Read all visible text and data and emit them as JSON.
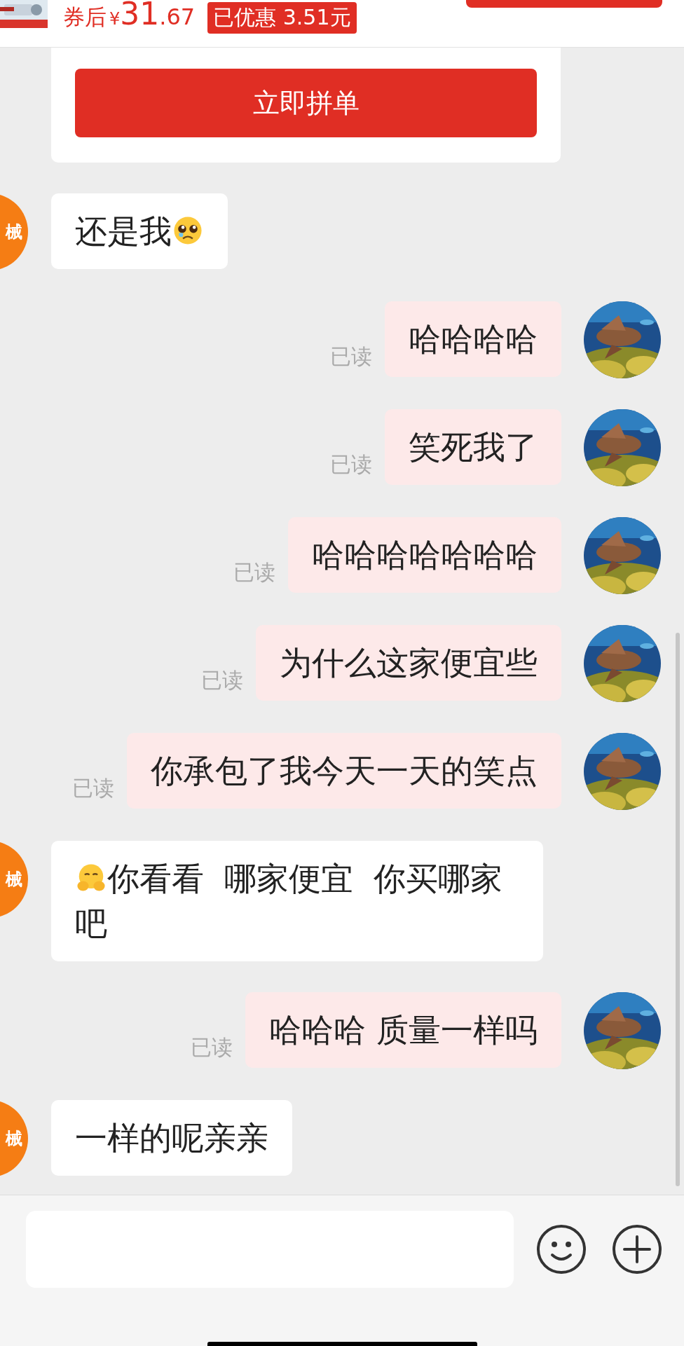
{
  "product": {
    "price_label": "券后",
    "currency": "¥",
    "price_int": "31",
    "price_dec": ".67",
    "discount": "已优惠 3.51元"
  },
  "order_button": "立即拼单",
  "messages": [
    {
      "kind": "incoming",
      "avatar_text": "械",
      "parts": [
        {
          "kind": "text",
          "text": "还是我"
        },
        {
          "kind": "pleading"
        }
      ]
    },
    {
      "kind": "outgoing",
      "status": "已读",
      "parts": [
        {
          "kind": "text",
          "text": "哈哈哈哈"
        }
      ]
    },
    {
      "kind": "outgoing",
      "status": "已读",
      "parts": [
        {
          "kind": "text",
          "text": "笑死我了"
        }
      ]
    },
    {
      "kind": "outgoing",
      "status": "已读",
      "parts": [
        {
          "kind": "text",
          "text": "哈哈哈哈哈哈哈"
        }
      ]
    },
    {
      "kind": "outgoing",
      "status": "已读",
      "parts": [
        {
          "kind": "text",
          "text": "为什么这家便宜些"
        }
      ]
    },
    {
      "kind": "outgoing",
      "status": "已读",
      "parts": [
        {
          "kind": "text",
          "text": "你承包了我今天一天的笑点"
        }
      ]
    },
    {
      "kind": "incoming",
      "avatar_text": "械",
      "parts": [
        {
          "kind": "covering"
        },
        {
          "kind": "text",
          "text": "你看看  哪家便宜  你买哪家吧"
        }
      ]
    },
    {
      "kind": "outgoing",
      "status": "已读",
      "parts": [
        {
          "kind": "text",
          "text": "哈哈哈 质量一样吗"
        }
      ]
    },
    {
      "kind": "incoming",
      "avatar_text": "械",
      "parts": [
        {
          "kind": "text",
          "text": "一样的呢亲亲"
        }
      ]
    }
  ]
}
